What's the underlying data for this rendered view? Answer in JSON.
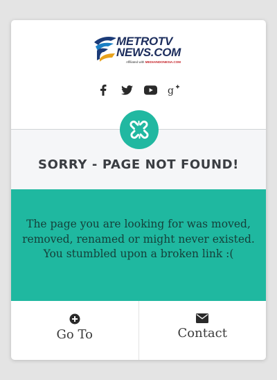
{
  "brand": {
    "line1": "METROTV",
    "line2": "NEWS.COM",
    "affiliation_prefix": "Affiliated with",
    "affiliation_name": "MEDIAINDONESIA.COM"
  },
  "social": [
    {
      "icon": "facebook-icon"
    },
    {
      "icon": "twitter-icon"
    },
    {
      "icon": "youtube-icon"
    },
    {
      "icon": "google-plus-icon"
    }
  ],
  "badge_icon": "broken-link-icon",
  "error": {
    "title": "SORRY - PAGE NOT FOUND!",
    "message_line1": "The page you are looking for was moved,",
    "message_line2": "removed, renamed or might never existed.",
    "message_line3": "You stumbled upon a broken link :("
  },
  "actions": {
    "goto": {
      "label": "Go To",
      "icon": "plus-circle-icon"
    },
    "contact": {
      "label": "Contact",
      "icon": "envelope-icon"
    }
  },
  "colors": {
    "accent": "#1fb8a0",
    "title_text": "#3a3d42",
    "band": "#f5f6f8"
  }
}
